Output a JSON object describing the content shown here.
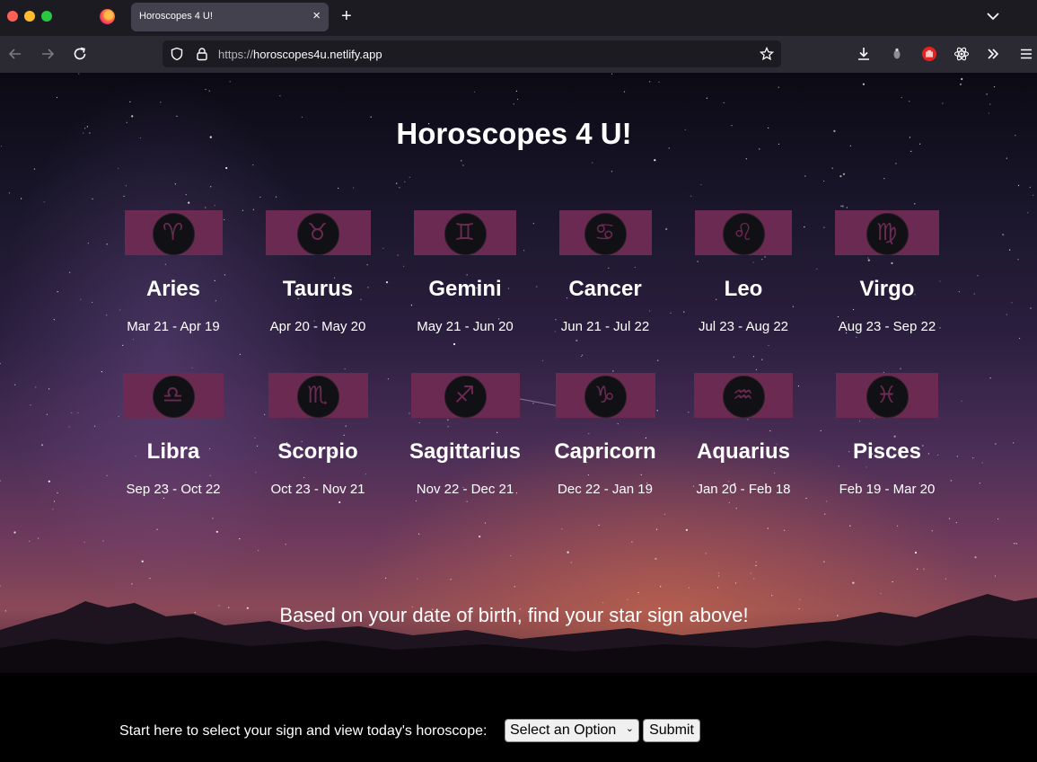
{
  "browser": {
    "tab_title": "Horoscopes 4 U!",
    "tab_close": "×",
    "new_tab": "+",
    "url_scheme": "https://",
    "url_host": "horoscopes4u.netlify.app"
  },
  "page": {
    "title": "Horoscopes 4 U!",
    "tagline": "Based on your date of birth, find your star sign above!",
    "start_label": "Start here to select your sign and view today's horoscope:",
    "select_value": "Select an Option",
    "select_arrow": "⌄",
    "submit_label": "Submit"
  },
  "signs": [
    {
      "name": "Aries",
      "dates": "Mar 21 - Apr 19",
      "glyph": "♈"
    },
    {
      "name": "Taurus",
      "dates": "Apr 20 - May 20",
      "glyph": "♉"
    },
    {
      "name": "Gemini",
      "dates": "May 21 - Jun 20",
      "glyph": "♊"
    },
    {
      "name": "Cancer",
      "dates": "Jun 21 - Jul 22",
      "glyph": "♋"
    },
    {
      "name": "Leo",
      "dates": "Jul 23 - Aug 22",
      "glyph": "♌"
    },
    {
      "name": "Virgo",
      "dates": "Aug 23 - Sep 22",
      "glyph": "♍"
    },
    {
      "name": "Libra",
      "dates": "Sep 23 - Oct 22",
      "glyph": "♎"
    },
    {
      "name": "Scorpio",
      "dates": "Oct 23 - Nov 21",
      "glyph": "♏"
    },
    {
      "name": "Sagittarius",
      "dates": "Nov 22 - Dec 21",
      "glyph": "♐"
    },
    {
      "name": "Capricorn",
      "dates": "Dec 22 - Jan 19",
      "glyph": "♑"
    },
    {
      "name": "Aquarius",
      "dates": "Jan 20 - Feb 18",
      "glyph": "♒"
    },
    {
      "name": "Pisces",
      "dates": "Feb 19 - Mar 20",
      "glyph": "♓"
    }
  ],
  "colors": {
    "banner": "#6b2a52",
    "disc": "#111015"
  }
}
